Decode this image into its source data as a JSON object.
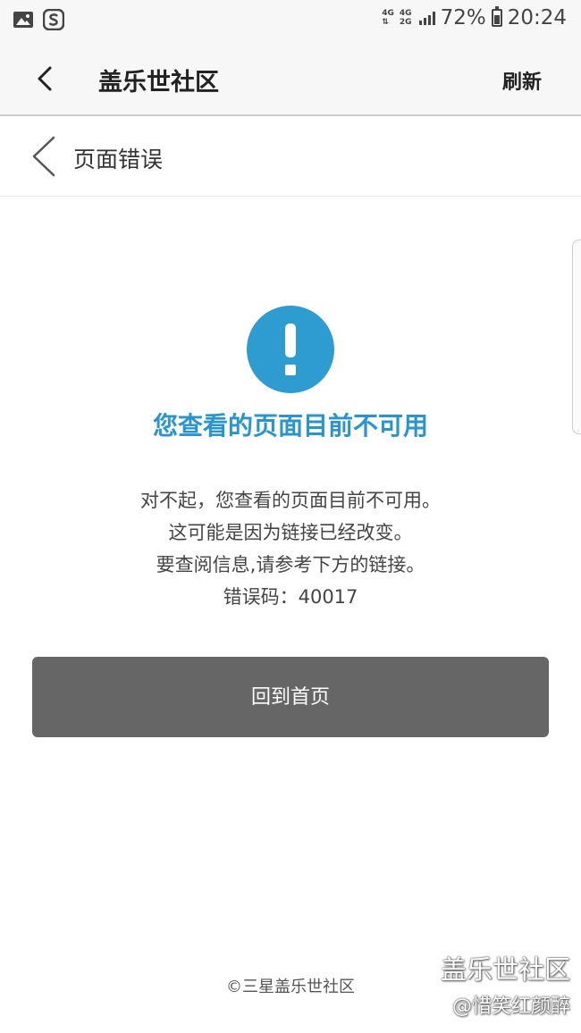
{
  "status_bar": {
    "network1_top": "4G",
    "network2_top": "4G",
    "network2_bottom": "2G",
    "battery_percent": "72%",
    "time": "20:24"
  },
  "app_bar": {
    "title": "盖乐世社区",
    "refresh_label": "刷新"
  },
  "page_header": {
    "title": "页面错误"
  },
  "error": {
    "heading": "您查看的页面目前不可用",
    "line1": "对不起，您查看的页面目前不可用。",
    "line2": "这可能是因为链接已经改变。",
    "line3": "要查阅信息,请参考下方的链接。",
    "line4": "错误码：40017"
  },
  "home_button_label": "回到首页",
  "footer": "©三星盖乐世社区",
  "watermark": {
    "line1": "盖乐世社区",
    "line2": "@惜笑红颜醉"
  },
  "colors": {
    "accent": "#2a95cc",
    "button": "#666666"
  }
}
